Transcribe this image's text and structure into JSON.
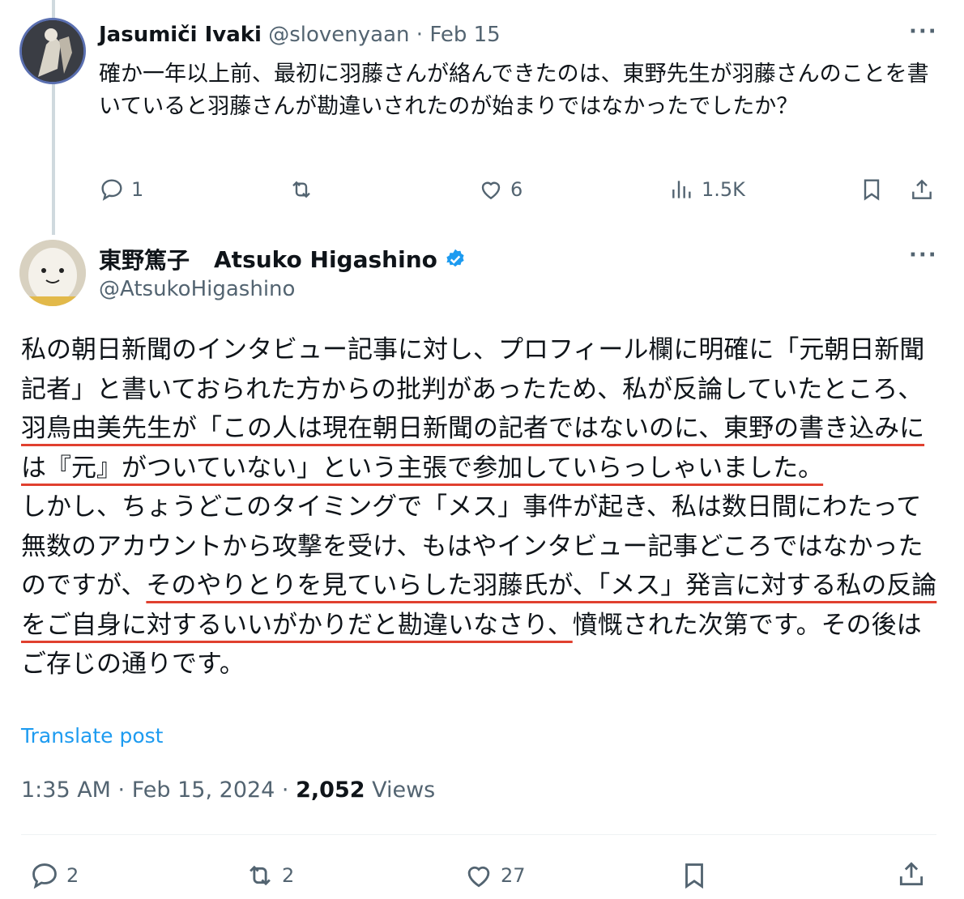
{
  "reply": {
    "name": "Jasumiči Ivaki",
    "handle": "@slovenyaan",
    "separator": "·",
    "date": "Feb 15",
    "text": "確か一年以上前、最初に羽藤さんが絡んできたのは、東野先生が羽藤さんのことを書いていると羽藤さんが勘違いされたのが始まりではなかったでしたか？",
    "more": "···",
    "actions": {
      "replies": "1",
      "reposts": "",
      "likes": "6",
      "views": "1.5K"
    }
  },
  "post": {
    "name_jp": "東野篤子",
    "name_en": "Atsuko Higashino",
    "handle": "@AtsukoHigashino",
    "more": "···",
    "verified_color": "#1d9bf0",
    "underline_color": "#e0402f",
    "p1_a": "私の朝日新聞のインタビュー記事に対し、プロフィール欄に明確に「元朝日新聞記者」と書いておられた方からの批判があったため、私が反論していたところ、",
    "p1_b": "羽鳥由美先生が「この人は現在朝日新聞の記者ではないのに、東野の書き込みには『元』がついていない」という主張で参加していらっしゃいました。",
    "p2_a": "しかし、ちょうどこのタイミングで「メス」事件が起き、私は数日間にわたって無数のアカウントから攻撃を受け、もはやインタビュー記事どころではなかったのですが、",
    "p2_b": "そのやりとりを見ていらした羽藤氏が、「メス」発言に対する私の反論をご自身に対するいいがかりだと勘違いなさり、",
    "p2_c": "憤慨された次第です。その後はご存じの通りです。",
    "translate": "Translate post",
    "time": "1:35 AM · Feb 15, 2024 · ",
    "views_count": "2,052",
    "views_label": " Views",
    "actions": {
      "replies": "2",
      "reposts": "2",
      "likes": "27"
    }
  }
}
